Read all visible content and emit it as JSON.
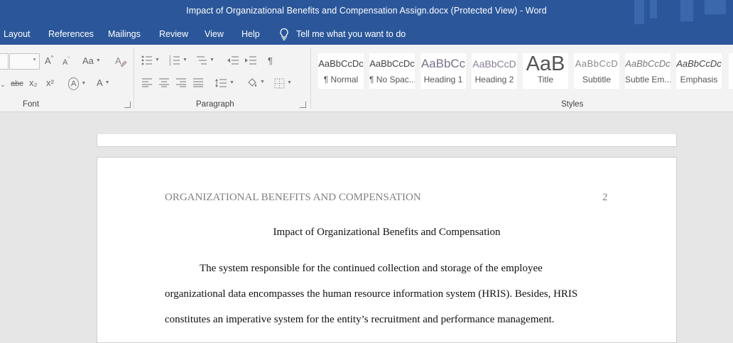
{
  "window": {
    "title": "Impact of Organizational Benefits and Compensation Assign.docx (Protected View)  -  Word"
  },
  "menu": {
    "items": [
      "Layout",
      "References",
      "Mailings",
      "Review",
      "View",
      "Help"
    ],
    "tell_me": "Tell me what you want to do"
  },
  "ribbon": {
    "groups": {
      "font": "Font",
      "paragraph": "Paragraph",
      "styles": "Styles"
    },
    "font_tools": {
      "grow": "A",
      "shrink": "A",
      "case": "Aa",
      "strike": "abc",
      "subscript": "x₂",
      "superscript": "x²",
      "effects": "A",
      "color": "A",
      "pilcrow": "¶"
    },
    "styles": [
      {
        "sample": "AaBbCcDc",
        "name": "¶ Normal"
      },
      {
        "sample": "AaBbCcDc",
        "name": "¶ No Spac..."
      },
      {
        "sample": "AaBbCc",
        "name": "Heading 1"
      },
      {
        "sample": "AaBbCcD",
        "name": "Heading 2"
      },
      {
        "sample": "AaB",
        "name": "Title"
      },
      {
        "sample": "AaBbCcD",
        "name": "Subtitle"
      },
      {
        "sample": "AaBbCcDc",
        "name": "Subtle Em..."
      },
      {
        "sample": "AaBbCcDc",
        "name": "Emphasis"
      }
    ]
  },
  "document": {
    "running_head": "ORGANIZATIONAL BENEFITS AND COMPENSATION",
    "page_number": "2",
    "title": "Impact of Organizational Benefits and Compensation",
    "lines": [
      "The system responsible for the continued collection and storage of the employee",
      "organizational data encompasses the human resource information system (HRIS). Besides, HRIS",
      "constitutes an imperative system for the entity’s recruitment and performance management."
    ]
  },
  "colors": {
    "title_bar": "#2b579a",
    "ribbon": "#f3f3f3",
    "canvas": "#e6e6e6"
  }
}
